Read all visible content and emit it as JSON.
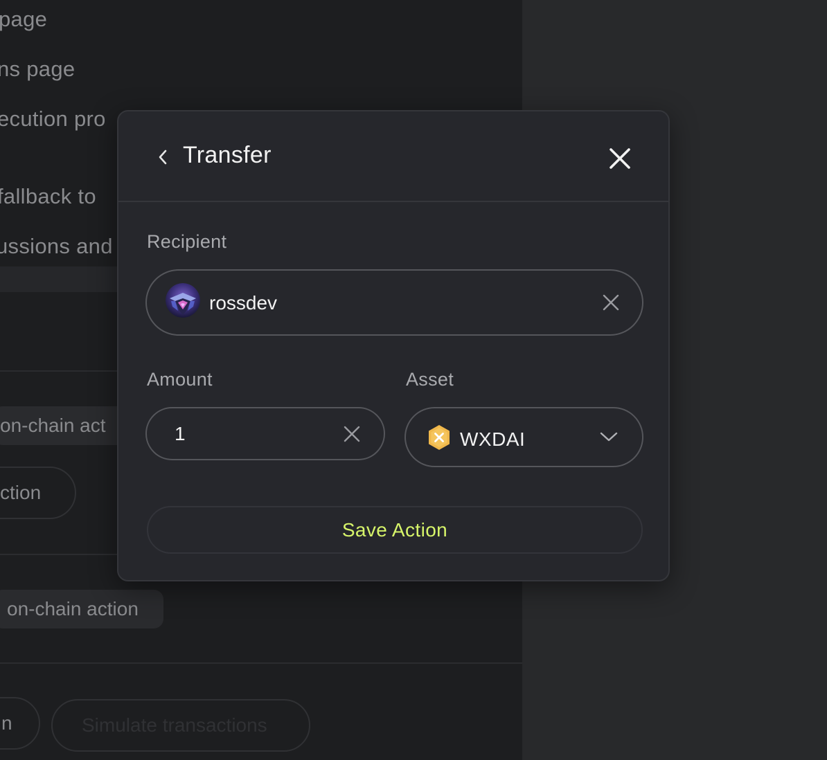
{
  "background": {
    "lines": [
      "page",
      "ns page",
      "ecution pro",
      "fallback to",
      "ussions and"
    ],
    "chip_1": "on-chain act",
    "pill_1": "ction",
    "chip_2": "on-chain action",
    "pill_2": "n",
    "pill_3": "Simulate transactions"
  },
  "modal": {
    "title": "Transfer",
    "back_icon": "chevron-left-icon",
    "close_icon": "close-icon",
    "recipient": {
      "label": "Recipient",
      "value": "rossdev",
      "clear_icon": "clear-icon"
    },
    "amount": {
      "label": "Amount",
      "value": "1",
      "clear_icon": "clear-icon"
    },
    "asset": {
      "label": "Asset",
      "value": "WXDAI",
      "token_icon": "wxdai-token-icon",
      "dropdown_icon": "chevron-down-icon"
    },
    "save_label": "Save Action",
    "accent_color": "#d7f56a"
  }
}
